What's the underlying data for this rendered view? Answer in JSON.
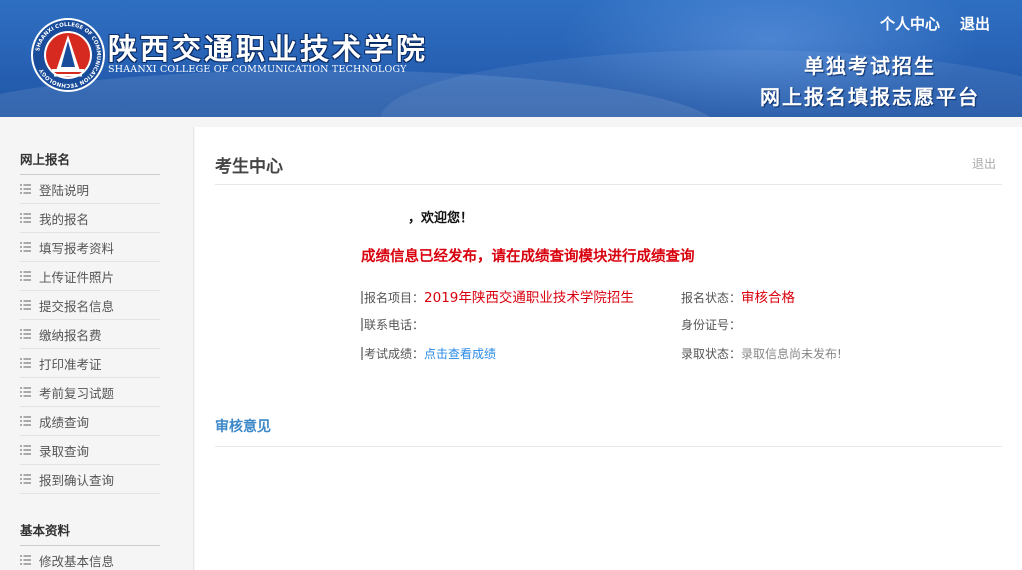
{
  "header": {
    "school_name": "陕西交通职业技术学院",
    "school_name_en": "SHAANXI COLLEGE OF COMMUNICATION TECHNOLOGY",
    "logo_text": "SHAANXI COLLEGE OF COMMUNICATION TECHNOLOGY",
    "links": [
      "个人中心",
      "退出"
    ],
    "platform_line1": "单独考试招生",
    "platform_line2": "网上报名填报志愿平台"
  },
  "sidebar": {
    "sections": [
      {
        "title": "网上报名",
        "items": [
          "登陆说明",
          "我的报名",
          "填写报考资料",
          "上传证件照片",
          "提交报名信息",
          "缴纳报名费",
          "打印准考证",
          "考前复习试题",
          "成绩查询",
          "录取查询",
          "报到确认查询"
        ]
      },
      {
        "title": "基本资料",
        "items": [
          "修改基本信息"
        ]
      }
    ]
  },
  "main": {
    "title": "考生中心",
    "logout": "退出",
    "welcome": "，欢迎您！",
    "notice": "成绩信息已经发布，请在成绩查询模块进行成绩查询",
    "fields": {
      "project_label": "报名项目：",
      "project_value": "2019年陕西交通职业技术学院招生",
      "status_label": "报名状态：",
      "status_value": "审核合格",
      "phone_label": "联系电话：",
      "id_label": "身份证号：",
      "score_label": "考试成绩：",
      "score_link": "点击查看成绩",
      "admit_label": "录取状态：",
      "admit_value": "录取信息尚未发布!"
    },
    "audit_title": "审核意见"
  },
  "colors": {
    "header_blue": "#2761b4",
    "notice_red": "#d9000d",
    "link_blue": "#2a8ae6",
    "section_blue": "#3c88c8"
  }
}
